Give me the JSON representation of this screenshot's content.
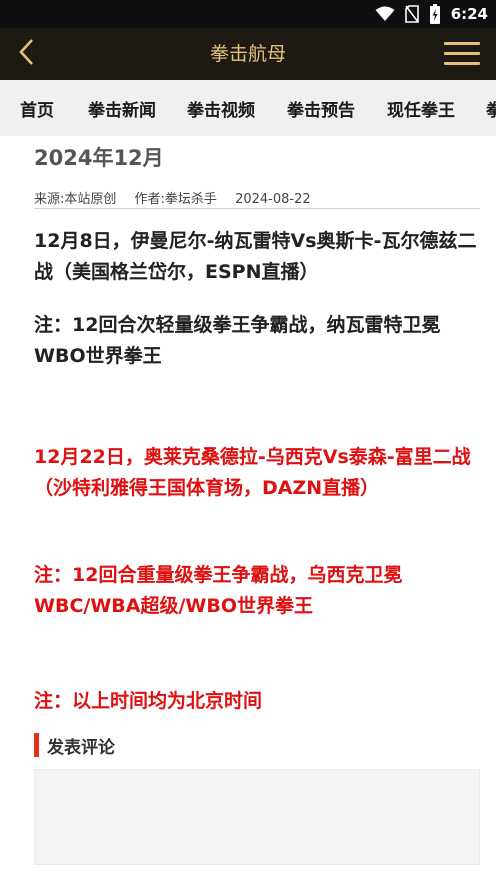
{
  "status_bar": {
    "time": "6:24"
  },
  "header": {
    "title": "拳击航母"
  },
  "nav": {
    "items": [
      "首页",
      "拳击新闻",
      "拳击视频",
      "拳击预告",
      "现任拳王",
      "拳"
    ]
  },
  "article": {
    "title": "2024年12月",
    "meta": {
      "source": "来源:本站原创",
      "author": "作者:拳坛杀手",
      "date": "2024-08-22"
    },
    "paragraphs": [
      "12月8日，伊曼尼尔-纳瓦雷特Vs奥斯卡-瓦尔德兹二战（美国格兰岱尔，ESPN直播）",
      "注：12回合次轻量级拳王争霸战，纳瓦雷特卫冕WBO世界拳王",
      "12月22日，奥莱克桑德拉-乌西克Vs泰森-富里二战（沙特利雅得王国体育场，DAZN直播）",
      "注：12回合重量级拳王争霸战，乌西克卫冕WBC/WBA超级/WBO世界拳王",
      "注：以上时间均为北京时间"
    ]
  },
  "comments": {
    "title": "发表评论"
  },
  "colors": {
    "header_bg": "#1d1a14",
    "accent_gold": "#e5c27a",
    "highlight_red": "#e01010",
    "comment_marker": "#e5301a"
  },
  "icons": [
    "wifi-icon",
    "no-sim-icon",
    "battery-icon",
    "back-arrow-icon",
    "hamburger-menu-icon"
  ]
}
